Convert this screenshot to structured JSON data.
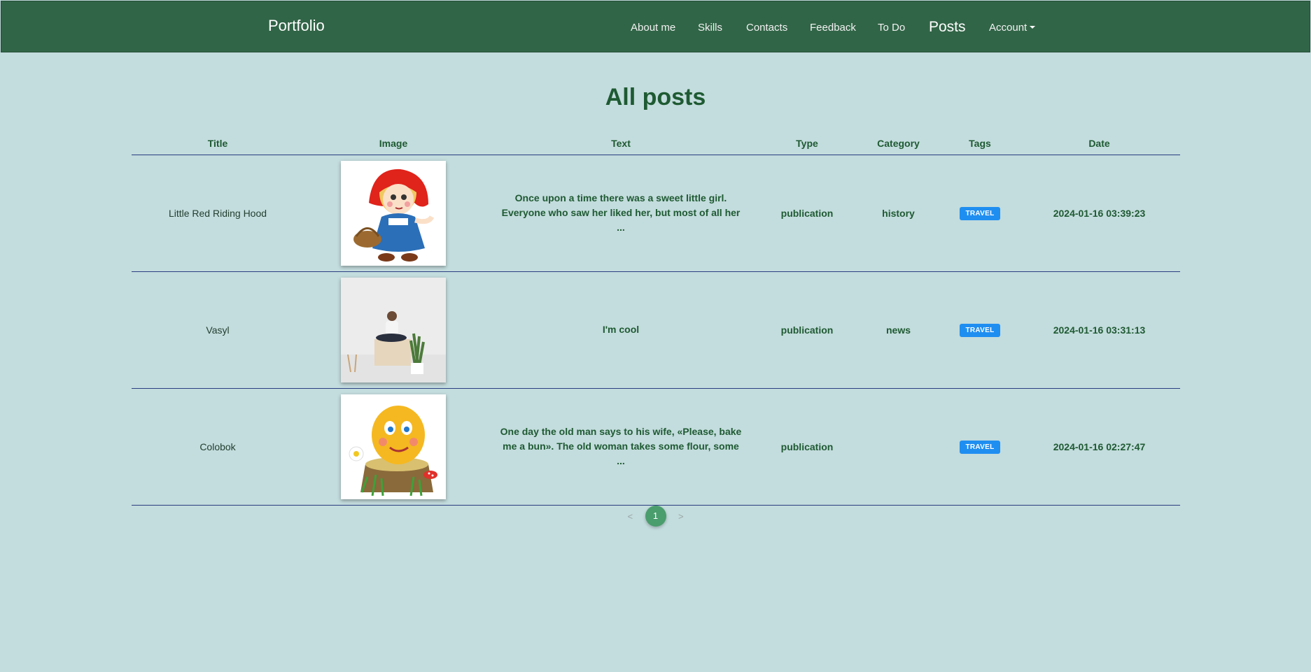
{
  "navbar": {
    "brand": "Portfolio",
    "items": [
      {
        "label": "About me"
      },
      {
        "label": "Skills"
      },
      {
        "label": "Contacts"
      },
      {
        "label": "Feedback"
      },
      {
        "label": "To Do"
      },
      {
        "label": "Posts"
      },
      {
        "label": "Account"
      }
    ]
  },
  "page": {
    "title": "All posts"
  },
  "table": {
    "headers": [
      "Title",
      "Image",
      "Text",
      "Type",
      "Category",
      "Tags",
      "Date"
    ],
    "rows": [
      {
        "title": "Little Red Riding Hood",
        "image": "red-riding-hood-cartoon",
        "text": "Once upon a time there was a sweet little girl. Everyone who saw her liked her, but most of all her ...",
        "type": "publication",
        "category": "history",
        "tag": "TRAVEL",
        "date": "2024-01-16 03:39:23"
      },
      {
        "title": "Vasyl",
        "image": "man-sitting-on-box-photo",
        "text": "I'm cool",
        "type": "publication",
        "category": "news",
        "tag": "TRAVEL",
        "date": "2024-01-16 03:31:13"
      },
      {
        "title": "Colobok",
        "image": "kolobok-cartoon",
        "text": "One day the old man says to his wife, «Please, bake me a bun». The old woman takes some flour, some ...",
        "type": "publication",
        "category": "",
        "tag": "TRAVEL",
        "date": "2024-01-16 02:27:47"
      }
    ]
  },
  "pagination": {
    "prev": "<",
    "current": "1",
    "next": ">"
  },
  "colors": {
    "navbar_bg": "#316547",
    "page_bg": "#c3dcdd",
    "accent_text": "#1e5a32",
    "tag_bg": "#1f8ef1",
    "pagination_active": "#4a9d6d"
  }
}
